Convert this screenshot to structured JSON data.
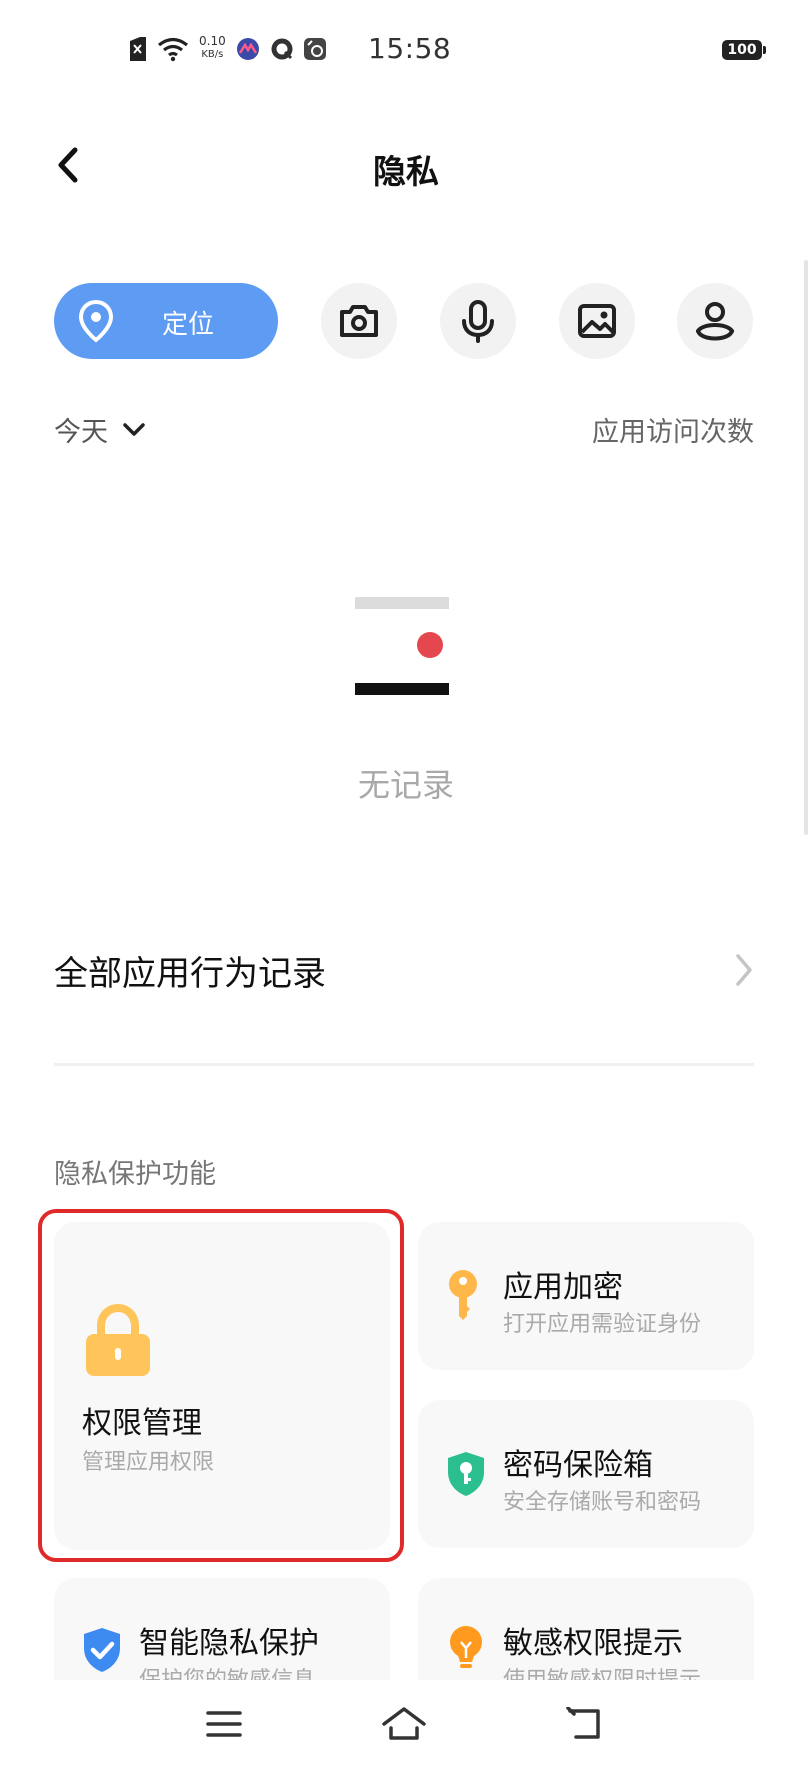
{
  "status_bar": {
    "time": "15:58",
    "net_speed_value": "0.10",
    "net_speed_unit": "KB/s",
    "battery": "100",
    "icons": [
      "sim-off-icon",
      "wifi-icon",
      "app-notification-icon",
      "chat-icon",
      "camera-app-icon"
    ]
  },
  "header": {
    "title": "隐私",
    "back_icon": "chevron-left-icon"
  },
  "filters": {
    "active_label": "定位",
    "active_icon": "location-pin-icon",
    "others": [
      "camera-icon",
      "microphone-icon",
      "photo-icon",
      "contacts-icon"
    ]
  },
  "period": {
    "label": "今天",
    "icon": "chevron-down-icon"
  },
  "sort_label": "应用访问次数",
  "empty_state": {
    "text": "无记录"
  },
  "all_records": {
    "label": "全部应用行为记录"
  },
  "section": {
    "label": "隐私保护功能"
  },
  "cards": {
    "permission": {
      "title": "权限管理",
      "subtitle": "管理应用权限",
      "icon": "lock-icon"
    },
    "app_lock": {
      "title": "应用加密",
      "subtitle": "打开应用需验证身份",
      "icon": "key-icon"
    },
    "password_vault": {
      "title": "密码保险箱",
      "subtitle": "安全存储账号和密码",
      "icon": "shield-key-icon"
    },
    "smart_privacy": {
      "title": "智能隐私保护",
      "subtitle": "保护您的敏感信息",
      "icon": "shield-check-icon"
    },
    "sensitive_alert": {
      "title": "敏感权限提示",
      "subtitle": "使用敏感权限时提示",
      "icon": "lightbulb-icon"
    }
  },
  "colors": {
    "accent": "#5e9cf3",
    "highlight_border": "#e02a2a",
    "lock_yellow": "#ffc55a",
    "vault_green": "#2bbf8f",
    "shield_blue": "#3d8bf0",
    "bulb_orange": "#ff9a1f"
  },
  "navbar": {
    "icons": [
      "menu-icon",
      "home-icon",
      "back-icon"
    ]
  }
}
